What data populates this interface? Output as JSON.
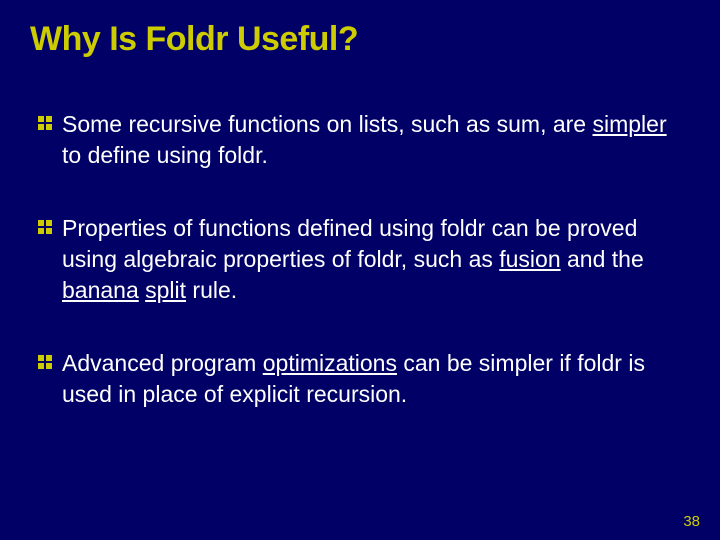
{
  "title": "Why Is Foldr Useful?",
  "bullets": [
    {
      "segments": [
        {
          "t": "Some recursive functions on lists, such as sum, are "
        },
        {
          "t": "simpler",
          "u": true
        },
        {
          "t": " to define using foldr."
        }
      ]
    },
    {
      "segments": [
        {
          "t": "Properties of functions defined using foldr can be proved using algebraic properties of foldr, such as "
        },
        {
          "t": "fusion",
          "u": true
        },
        {
          "t": " and the "
        },
        {
          "t": "banana",
          "u": true
        },
        {
          "t": " "
        },
        {
          "t": "split",
          "u": true
        },
        {
          "t": " rule."
        }
      ]
    },
    {
      "segments": [
        {
          "t": "Advanced program "
        },
        {
          "t": "optimizations",
          "u": true
        },
        {
          "t": " can be simpler if foldr is used in place of explicit recursion."
        }
      ]
    }
  ],
  "page_number": "38",
  "icon_color": "#cccc00"
}
